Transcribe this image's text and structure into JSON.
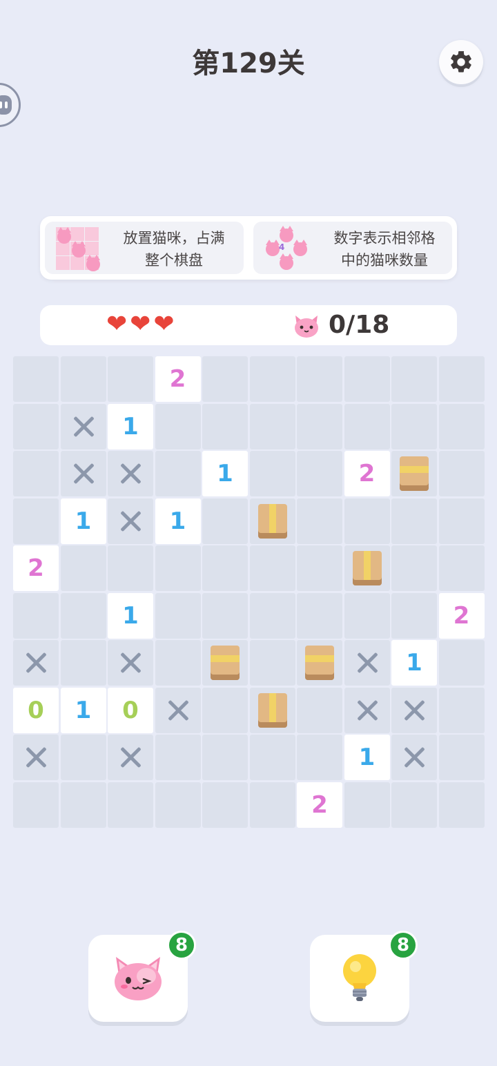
{
  "header": {
    "title": "第129关",
    "settings_icon": "gear-icon",
    "floating_icon": "assistant-face-icon"
  },
  "rules": [
    {
      "text": "放置猫咪，占满\n整个棋盘",
      "icon": "cat-grid-icon"
    },
    {
      "text": "数字表示相邻格\n中的猫咪数量",
      "icon": "cat-number-4-icon",
      "icon_number": "4"
    }
  ],
  "status": {
    "lives": 3,
    "heart_glyph": "❤",
    "cats_placed": "0/18",
    "cat_icon": "cat-face-icon"
  },
  "colors": {
    "background": "#e8ebf7",
    "clue_0": "#a6cf58",
    "clue_1": "#3aa9ea",
    "clue_2": "#df75d2",
    "heart": "#e8443a",
    "badge": "#28a340",
    "box": "#e2b884"
  },
  "board": {
    "size": 10,
    "legend": {
      "E": "empty",
      "X": "crossed",
      "BV": "box-vertical-tape",
      "BH": "box-horizontal-tape",
      "0": "clue 0",
      "1": "clue 1",
      "2": "clue 2"
    },
    "rows": [
      [
        "E",
        "E",
        "E",
        "2",
        "E",
        "E",
        "E",
        "E",
        "E",
        "E"
      ],
      [
        "E",
        "X",
        "1",
        "E",
        "E",
        "E",
        "E",
        "E",
        "E",
        "E"
      ],
      [
        "E",
        "X",
        "X",
        "E",
        "1",
        "E",
        "E",
        "2",
        "BH",
        "E"
      ],
      [
        "E",
        "1",
        "X",
        "1",
        "E",
        "BV",
        "E",
        "E",
        "E",
        "E"
      ],
      [
        "2",
        "E",
        "E",
        "E",
        "E",
        "E",
        "E",
        "BV",
        "E",
        "E"
      ],
      [
        "E",
        "E",
        "1",
        "E",
        "E",
        "E",
        "E",
        "E",
        "E",
        "2"
      ],
      [
        "X",
        "E",
        "X",
        "E",
        "BH",
        "E",
        "BH",
        "X",
        "1",
        "E"
      ],
      [
        "0",
        "1",
        "0",
        "X",
        "E",
        "BV",
        "E",
        "X",
        "X",
        "E"
      ],
      [
        "X",
        "E",
        "X",
        "E",
        "E",
        "E",
        "E",
        "1",
        "X",
        "E"
      ],
      [
        "E",
        "E",
        "E",
        "E",
        "E",
        "E",
        "2",
        "E",
        "E",
        "E"
      ]
    ]
  },
  "tools": {
    "cat": {
      "icon": "winking-cat-icon",
      "count": "8"
    },
    "hint": {
      "icon": "lightbulb-icon",
      "count": "8"
    }
  }
}
